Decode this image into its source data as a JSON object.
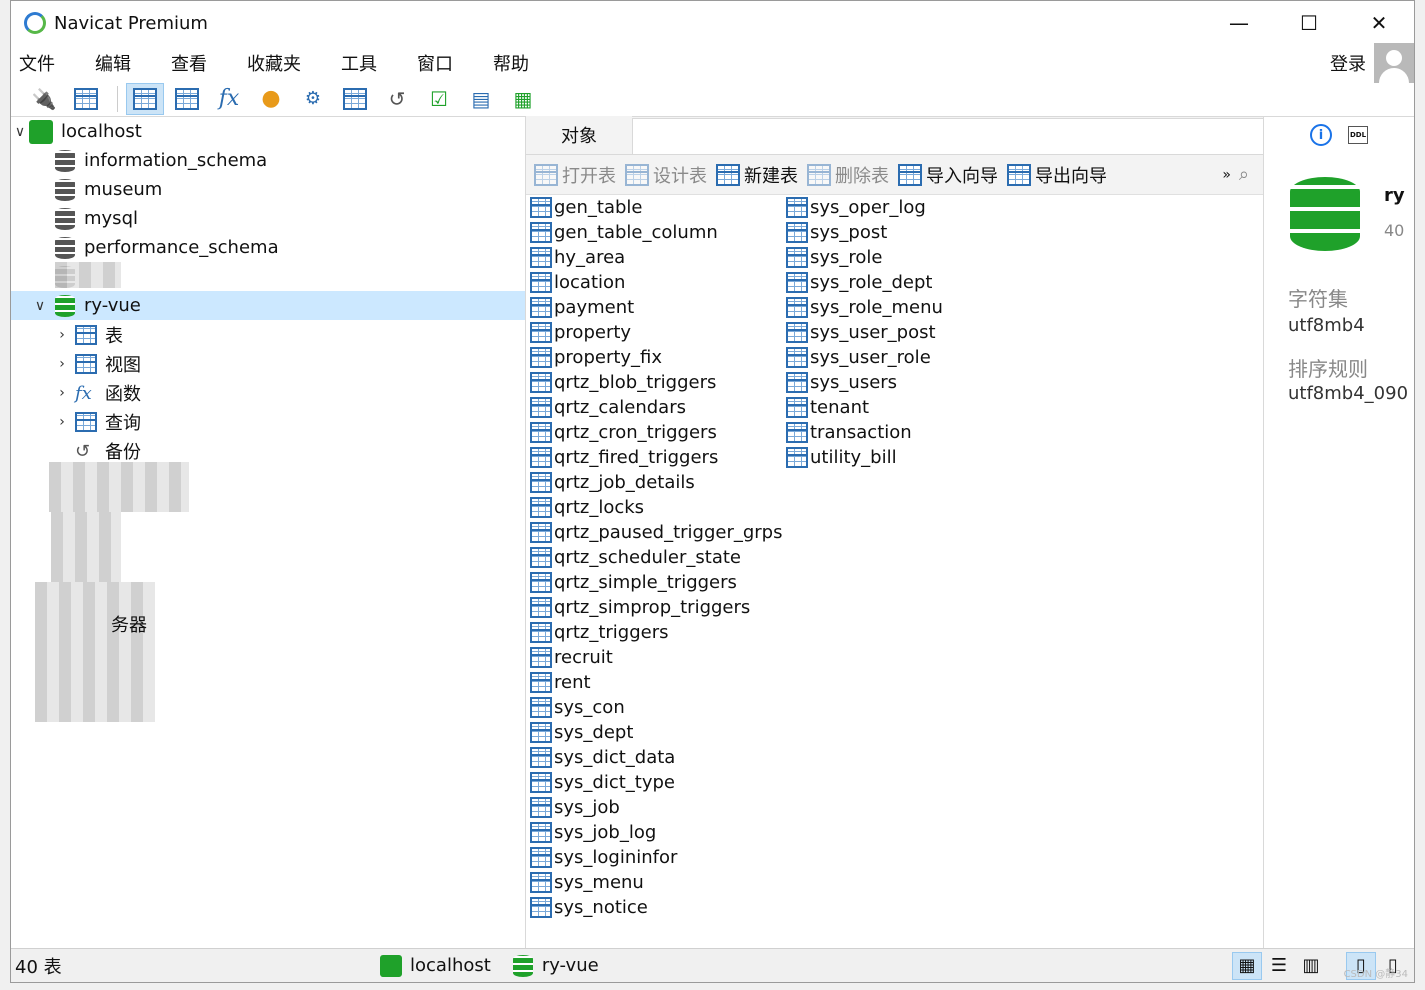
{
  "window": {
    "title": "Navicat Premium",
    "minimize": "—",
    "maximize": "☐",
    "close": "✕"
  },
  "menu": [
    "文件",
    "编辑",
    "查看",
    "收藏夹",
    "工具",
    "窗口",
    "帮助"
  ],
  "login": "登录",
  "toolbar_icons": [
    "connection-icon",
    "new-query-icon",
    "table-icon",
    "view-icon",
    "function-icon",
    "user-icon",
    "tools-icon",
    "query-icon",
    "backup-icon",
    "schedule-icon",
    "model-icon",
    "chart-icon"
  ],
  "tree": {
    "connection": "localhost",
    "databases": [
      "information_schema",
      "museum",
      "mysql",
      "performance_schema"
    ],
    "active_db": "ry-vue",
    "children": [
      "表",
      "视图",
      "函数",
      "查询",
      "备份"
    ],
    "partial_text": "务器"
  },
  "tabs": {
    "objects": "对象"
  },
  "objbar": {
    "open": "打开表",
    "design": "设计表",
    "new": "新建表",
    "delete": "删除表",
    "import": "导入向导",
    "export": "导出向导",
    "more": "»"
  },
  "tables_col1": [
    "gen_table",
    "gen_table_column",
    "hy_area",
    "location",
    "payment",
    "property",
    "property_fix",
    "qrtz_blob_triggers",
    "qrtz_calendars",
    "qrtz_cron_triggers",
    "qrtz_fired_triggers",
    "qrtz_job_details",
    "qrtz_locks",
    "qrtz_paused_trigger_grps",
    "qrtz_scheduler_state",
    "qrtz_simple_triggers",
    "qrtz_simprop_triggers",
    "qrtz_triggers",
    "recruit",
    "rent",
    "sys_con",
    "sys_dept",
    "sys_dict_data",
    "sys_dict_type",
    "sys_job",
    "sys_job_log",
    "sys_logininfor",
    "sys_menu",
    "sys_notice"
  ],
  "tables_col2": [
    "sys_oper_log",
    "sys_post",
    "sys_role",
    "sys_role_dept",
    "sys_role_menu",
    "sys_user_post",
    "sys_user_role",
    "sys_users",
    "tenant",
    "transaction",
    "utility_bill"
  ],
  "info": {
    "name": "ry",
    "count": "40",
    "charset_label": "字符集",
    "charset": "utf8mb4",
    "collation_label": "排序规则",
    "collation": "utf8mb4_090"
  },
  "status": {
    "count": "40 表",
    "connection": "localhost",
    "database": "ry-vue",
    "watermark": "CSDN @静34"
  }
}
